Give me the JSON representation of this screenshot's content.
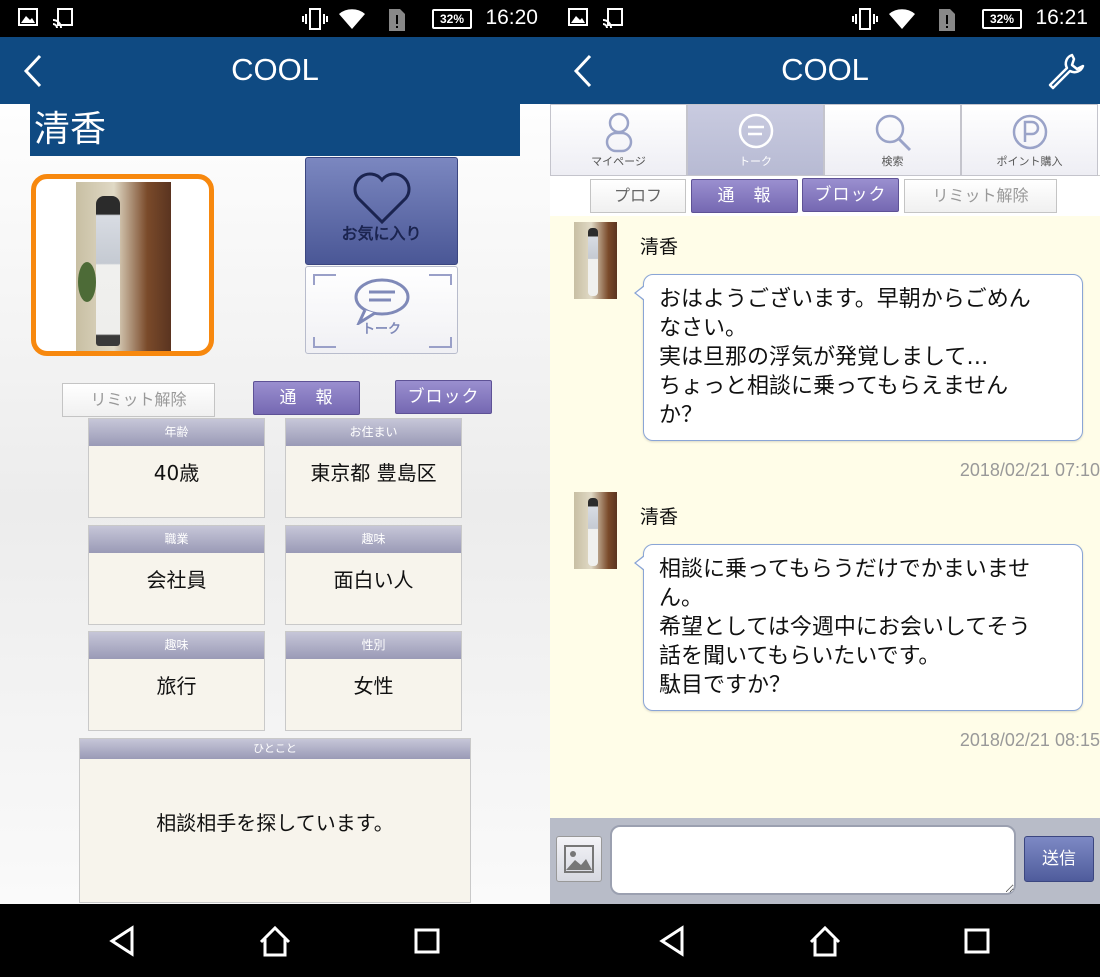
{
  "status_left": {
    "time": "16:20",
    "battery": "32%"
  },
  "status_right": {
    "time": "16:21",
    "battery": "32%"
  },
  "app": {
    "title": "COOL"
  },
  "profile": {
    "name": "清香",
    "favorite_label": "お気に入り",
    "talk_label": "トーク",
    "limit_release": "リミット解除",
    "report": "通　報",
    "block": "ブロック",
    "fields": [
      {
        "label": "年齢",
        "value": "40歳"
      },
      {
        "label": "お住まい",
        "value": "東京都 豊島区"
      },
      {
        "label": "職業",
        "value": "会社員"
      },
      {
        "label": "趣味",
        "value": "面白い人"
      },
      {
        "label": "趣味",
        "value": "旅行"
      },
      {
        "label": "性別",
        "value": "女性"
      }
    ],
    "hitokoto": {
      "label": "ひとこと",
      "value": "相談相手を探しています。"
    }
  },
  "chat": {
    "tabs": [
      {
        "label": "マイページ",
        "icon": "person-icon"
      },
      {
        "label": "トーク",
        "icon": "speech-bubble-icon"
      },
      {
        "label": "検索",
        "icon": "search-icon"
      },
      {
        "label": "ポイント購入",
        "icon": "point-icon"
      }
    ],
    "subtabs": {
      "profile": "プロフ",
      "report": "通　報",
      "block": "ブロック",
      "limit_release": "リミット解除"
    },
    "messages": [
      {
        "sender": "清香",
        "lines": [
          "おはようございます。早朝からごめん",
          "なさい。",
          "実は旦那の浮気が発覚しまして…",
          "ちょっと相談に乗ってもらえません",
          "か？"
        ],
        "time": "2018/02/21 07:10"
      },
      {
        "sender": "清香",
        "lines": [
          "相談に乗ってもらうだけでかまいませ",
          "ん。",
          "希望としては今週中にお会いしてそう",
          "話を聞いてもらいたいです。",
          "駄目ですか？"
        ],
        "time": "2018/02/21 08:15"
      }
    ],
    "input_placeholder": "",
    "send_label": "送信"
  },
  "colors": {
    "appbar": "#0f4a82",
    "accent_orange": "#f7880e",
    "purple_button": "#7568b2",
    "chat_bg": "#fffde8"
  }
}
